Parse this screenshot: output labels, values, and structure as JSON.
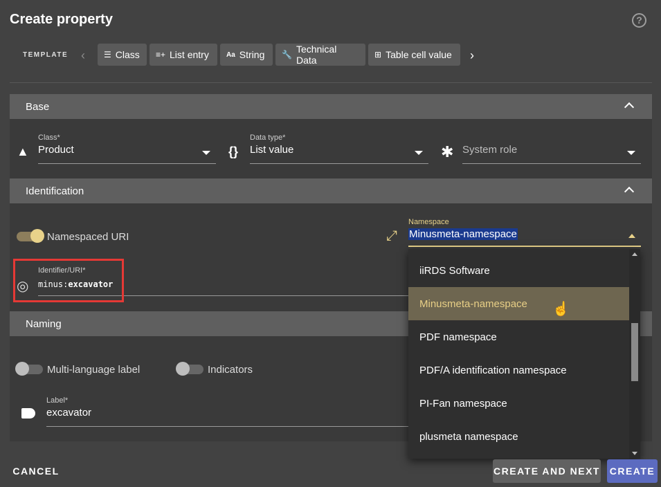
{
  "dialog": {
    "title": "Create property"
  },
  "template": {
    "label": "TEMPLATE",
    "chips": [
      {
        "icon": "class-icon",
        "label": "Class"
      },
      {
        "icon": "list-add-icon",
        "label": "List entry"
      },
      {
        "icon": "text-icon",
        "label": "String"
      },
      {
        "icon": "wrench-icon",
        "label": "Technical Data"
      },
      {
        "icon": "table-icon",
        "label": "Table cell value"
      }
    ]
  },
  "base": {
    "header": "Base",
    "class": {
      "label": "Class*",
      "value": "Product"
    },
    "data_type": {
      "label": "Data type*",
      "value": "List value"
    },
    "system_role": {
      "placeholder": "System role"
    }
  },
  "identification": {
    "header": "Identification",
    "namespaced_uri": {
      "label": "Namespaced URI",
      "on": true
    },
    "namespace": {
      "label": "Namespace",
      "value": "Minusmeta-namespace"
    },
    "identifier": {
      "label": "Identifier/URI*",
      "prefix": "minus:",
      "value": "excavator"
    }
  },
  "naming": {
    "header": "Naming",
    "multi_language": {
      "label": "Multi-language label",
      "on": false
    },
    "indicators": {
      "label": "Indicators",
      "on": false
    },
    "label_field": {
      "label": "Label*",
      "value": "excavator"
    }
  },
  "namespace_options": [
    "iiRDS Software",
    "Minusmeta-namespace",
    "PDF namespace",
    "PDF/A identification namespace",
    "PI-Fan namespace",
    "plusmeta namespace"
  ],
  "selected_option_index": 1,
  "actions": {
    "cancel": "CANCEL",
    "create_next": "CREATE AND NEXT",
    "create": "CREATE"
  },
  "colors": {
    "accent": "#e8d28a",
    "primary_button": "#5c6bc0",
    "selected_row": "#6e6650"
  }
}
